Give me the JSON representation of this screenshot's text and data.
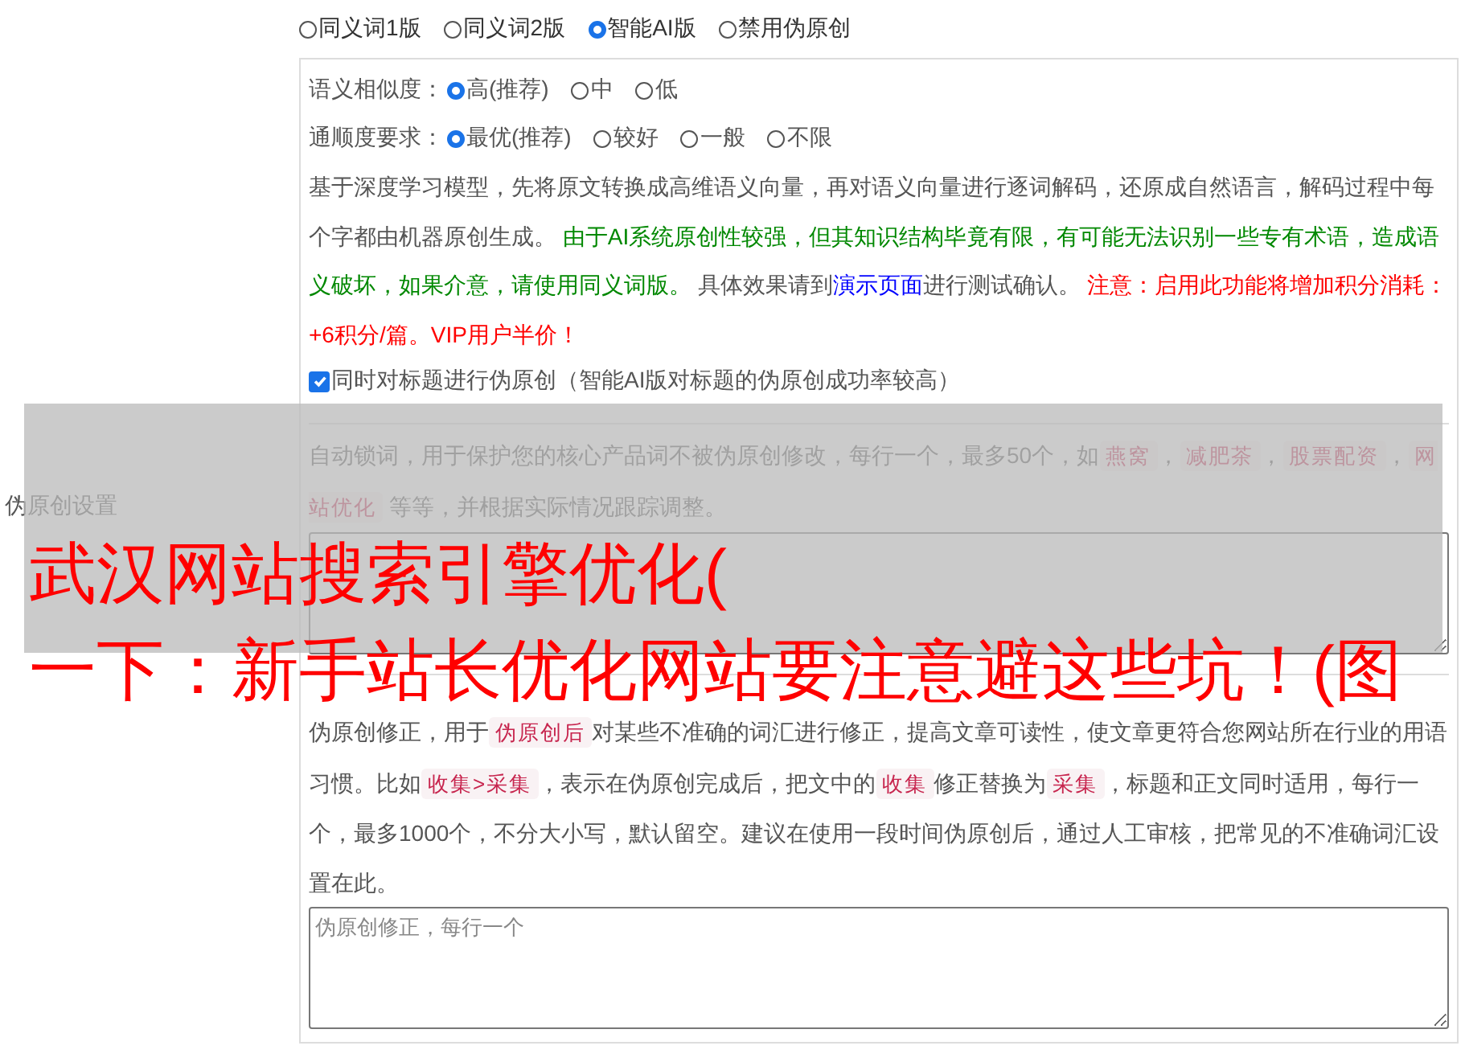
{
  "version_options": [
    {
      "label": "同义词1版",
      "selected": false
    },
    {
      "label": "同义词2版",
      "selected": false
    },
    {
      "label": "智能AI版",
      "selected": true
    },
    {
      "label": "禁用伪原创",
      "selected": false
    }
  ],
  "section_label": "伪原创设置",
  "similarity": {
    "label": "语义相似度：",
    "options": [
      {
        "label": "高(推荐)",
        "selected": true
      },
      {
        "label": "中",
        "selected": false
      },
      {
        "label": "低",
        "selected": false
      }
    ]
  },
  "fluency": {
    "label": "通顺度要求：",
    "options": [
      {
        "label": "最优(推荐)",
        "selected": true
      },
      {
        "label": "较好",
        "selected": false
      },
      {
        "label": "一般",
        "selected": false
      },
      {
        "label": "不限",
        "selected": false
      }
    ]
  },
  "ai_note": [
    {
      "kind": "text",
      "text": "基于深度学习模型，先将原文转换成高维语义向量，再对语义向量进行逐词解码，还原成自然语言，解码过程中每个字都由机器原创生成。 "
    },
    {
      "kind": "hint",
      "text": "由于AI系统原创性较强，但其知识结构毕竟有限，有可能无法识别一些专有术语，造成语义破坏，如果介意，请使用同义词版。"
    },
    {
      "kind": "text",
      "text": " 具体效果请到"
    },
    {
      "kind": "link",
      "text": "演示页面"
    },
    {
      "kind": "text",
      "text": "进行测试确认。 "
    },
    {
      "kind": "warning",
      "text": "注意：启用此功能将增加积分消耗：+6积分/篇。VIP用户半价！"
    }
  ],
  "title_option": {
    "label": "同时对标题进行伪原创（智能AI版对标题的伪原创成功率较高）",
    "checked": true
  },
  "lock_words": {
    "description": [
      {
        "kind": "text",
        "text": "自动锁词，用于保护您的核心产品词不被伪原创修改，每行一个，最多50个，如"
      },
      {
        "kind": "tag",
        "text": "燕窝"
      },
      {
        "kind": "text",
        "text": "，"
      },
      {
        "kind": "tag",
        "text": "减肥茶"
      },
      {
        "kind": "text",
        "text": "，"
      },
      {
        "kind": "tag",
        "text": "股票配资"
      },
      {
        "kind": "text",
        "text": "，"
      },
      {
        "kind": "tag",
        "text": "网站优化"
      },
      {
        "kind": "text",
        "text": " 等等，并根据实际情况跟踪调整。"
      }
    ]
  },
  "correction": {
    "description": [
      {
        "kind": "text",
        "text": "伪原创修正，用于"
      },
      {
        "kind": "tag",
        "text": "伪原创后"
      },
      {
        "kind": "text",
        "text": "对某些不准确的词汇进行修正，提高文章可读性，使文章更符合您网站所在行业的用语习惯。比如"
      },
      {
        "kind": "tag",
        "text": "收集>采集"
      },
      {
        "kind": "text",
        "text": "，表示在伪原创完成后，把文中的"
      },
      {
        "kind": "tag",
        "text": "收集"
      },
      {
        "kind": "text",
        "text": "修正替换为"
      },
      {
        "kind": "tag",
        "text": "采集"
      },
      {
        "kind": "text",
        "text": "，标题和正文同时适用，每行一个，最多1000个，不分大小写，默认留空。建议在使用一段时间伪原创后，通过人工审核，把常见的不准确词汇设置在此。"
      }
    ],
    "placeholder": "伪原创修正，每行一个"
  },
  "overlay": {
    "lines": [
      "武汉网站搜索引擎优化(",
      "一下：新手站长优化网站要注意避这些坑！(图"
    ]
  }
}
